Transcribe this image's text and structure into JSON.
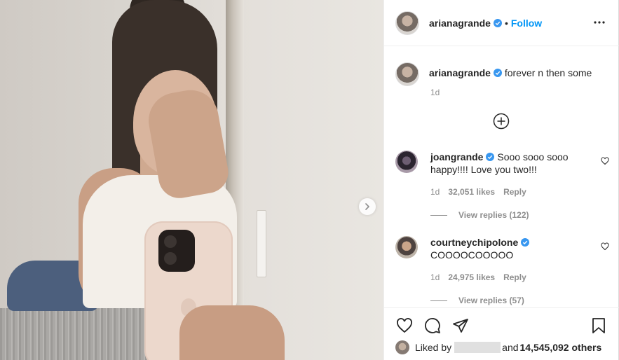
{
  "post": {
    "author": "arianagrande",
    "follow_label": "Follow",
    "separator": "•"
  },
  "caption": {
    "username": "arianagrande",
    "text": "forever n then some",
    "time": "1d"
  },
  "comments": [
    {
      "username": "joangrande",
      "text": "Sooo sooo sooo happy!!!! Love you two!!!",
      "time": "1d",
      "likes": "32,051 likes",
      "reply_label": "Reply",
      "view_replies": "View replies (122)"
    },
    {
      "username": "courtneychipolone",
      "text": "COOOOCOOOOO",
      "time": "1d",
      "likes": "24,975 likes",
      "reply_label": "Reply",
      "view_replies": "View replies (57)"
    }
  ],
  "likes_bar": {
    "prefix": "Liked by",
    "and": "and",
    "count": "14,545,092 others"
  },
  "icons": {
    "carousel": "chevron-right-icon",
    "more": "more-horizontal-icon",
    "load_more": "plus-circle-icon",
    "like": "heart-icon",
    "comment": "comment-icon",
    "share": "paper-plane-icon",
    "save": "bookmark-icon",
    "verified": "verified-badge-icon"
  },
  "colors": {
    "accent": "#0095f6",
    "muted": "#8e8e8e",
    "text": "#262626",
    "border": "#efefef"
  }
}
